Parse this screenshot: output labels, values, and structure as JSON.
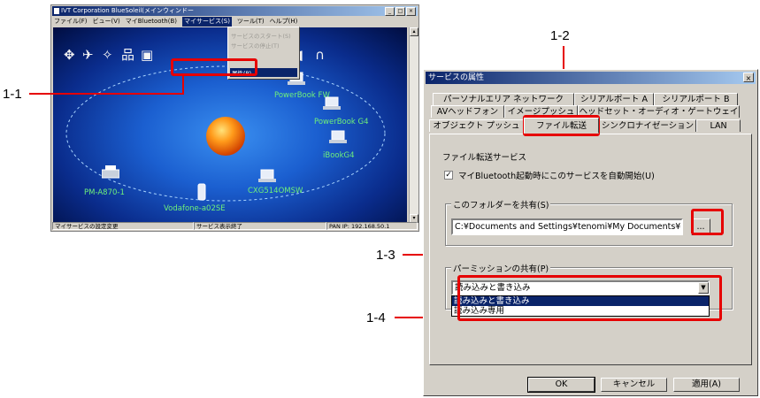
{
  "left_window": {
    "title": "IVT Corporation BlueSoleil(メインウィンドー",
    "menu": [
      "ファイル(F)",
      "ビュー(V)",
      "マイBluetooth(B)",
      "マイサービス(S)",
      "ツール(T)",
      "ヘルプ(H)"
    ],
    "active_menu": "マイサービス(S)",
    "dropdown_items": [
      "サービスのスタート(S)",
      "サービスの停止(T)"
    ],
    "dropdown_selected": "属性(P)",
    "devices": [
      "PowerBook FW",
      "PowerBook G4",
      "iBookG4",
      "CXG514OMSW",
      "Vodafone-a02SE",
      "PM-A870-1"
    ],
    "status": [
      "マイサービスの設定変更",
      "サービス表示終了",
      "PAN IP: 192.168.50.1"
    ]
  },
  "callouts": {
    "c1_1": "1-1",
    "c1_2": "1-2",
    "c1_3": "1-3",
    "c1_4": "1-4"
  },
  "dialog": {
    "title": "サービスの属性",
    "close": "×",
    "tabs_row1": [
      "パーソナルエリア ネットワーク",
      "シリアルポート A",
      "シリアルポート B"
    ],
    "tabs_row2": [
      "AVヘッドフォン",
      "イメージプッシュ",
      "ヘッドセット・オーディオ・ゲートウェイ"
    ],
    "tabs_row3": [
      "オブジェクト プッシュ",
      "ファイル転送",
      "シンクロナイゼーション",
      "LAN"
    ],
    "active_tab": "ファイル転送",
    "service_name": "ファイル転送サービス",
    "autostart_label": "マイBluetooth起動時にこのサービスを自動開始(U)",
    "autostart_checked": "✓",
    "share_group_title": "このフォルダーを共有(S)",
    "folder_path": "C:¥Documents and Settings¥tenomi¥My Documents¥",
    "browse_label": "...",
    "perm_group_title": "パーミッションの共有(P)",
    "perm_value": "読み込みと書き込み",
    "perm_options": [
      "読み込みと書き込み",
      "読み込み専用"
    ],
    "ok": "OK",
    "cancel": "キャンセル",
    "apply": "適用(A)"
  },
  "colors": {
    "accent_red": "#e60000",
    "title_blue": "#0a246a",
    "device_label": "#6ff07a"
  }
}
